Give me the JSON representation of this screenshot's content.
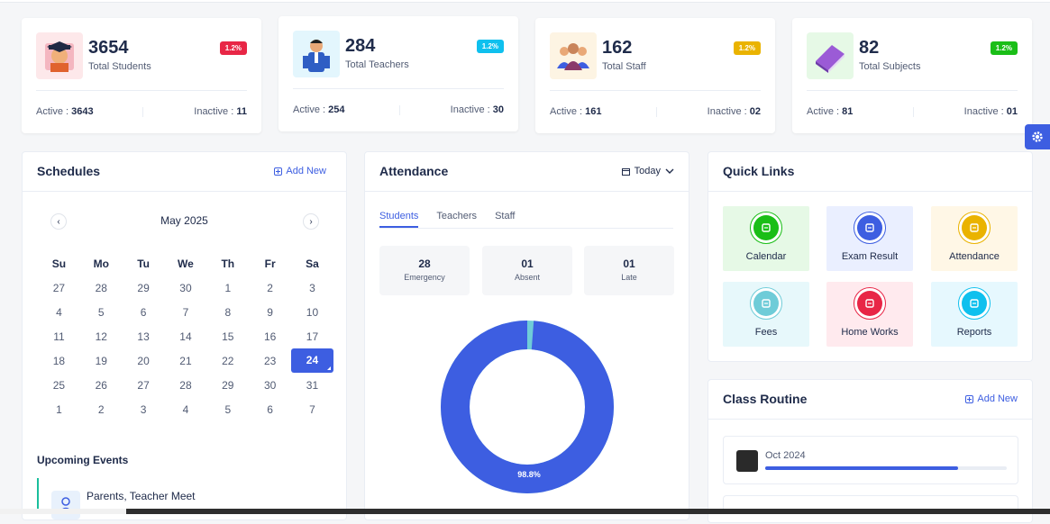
{
  "stats": [
    {
      "value": "3654",
      "label": "Total Students",
      "percent": "1.2%",
      "badge_color": "#e82646",
      "active_label": "Active :",
      "active": "3643",
      "inactive_label": "Inactive :",
      "inactive": "11",
      "icon": "student-graduate-icon"
    },
    {
      "value": "284",
      "label": "Total Teachers",
      "percent": "1.2%",
      "badge_color": "#0fc0ee",
      "active_label": "Active :",
      "active": "254",
      "inactive_label": "Inactive :",
      "inactive": "30",
      "icon": "teacher-icon"
    },
    {
      "value": "162",
      "label": "Total Staff",
      "percent": "1.2%",
      "badge_color": "#eab300",
      "active_label": "Active :",
      "active": "161",
      "inactive_label": "Inactive :",
      "inactive": "02",
      "icon": "staff-group-icon"
    },
    {
      "value": "82",
      "label": "Total Subjects",
      "percent": "1.2%",
      "badge_color": "#1abe17",
      "active_label": "Active :",
      "active": "81",
      "inactive_label": "Inactive :",
      "inactive": "01",
      "icon": "book-icon"
    }
  ],
  "schedules": {
    "title": "Schedules",
    "add_new": "Add New",
    "month": "May 2025",
    "weekdays": [
      "Su",
      "Mo",
      "Tu",
      "We",
      "Th",
      "Fr",
      "Sa"
    ],
    "weeks": [
      [
        "27",
        "28",
        "29",
        "30",
        "1",
        "2",
        "3"
      ],
      [
        "4",
        "5",
        "6",
        "7",
        "8",
        "9",
        "10"
      ],
      [
        "11",
        "12",
        "13",
        "14",
        "15",
        "16",
        "17"
      ],
      [
        "18",
        "19",
        "20",
        "21",
        "22",
        "23",
        "24"
      ],
      [
        "25",
        "26",
        "27",
        "28",
        "29",
        "30",
        "31"
      ],
      [
        "1",
        "2",
        "3",
        "4",
        "5",
        "6",
        "7"
      ]
    ],
    "selected_day": "24",
    "upcoming_title": "Upcoming Events",
    "event_name": "Parents, Teacher Meet"
  },
  "attendance": {
    "title": "Attendance",
    "filter": "Today",
    "tabs": [
      "Students",
      "Teachers",
      "Staff"
    ],
    "active_tab": "Students",
    "boxes": [
      {
        "value": "28",
        "label": "Emergency"
      },
      {
        "value": "01",
        "label": "Absent"
      },
      {
        "value": "01",
        "label": "Late"
      }
    ],
    "donut_label": "98.8%",
    "donut_fraction": 0.988,
    "donut_colors": {
      "main": "#3d5ee1",
      "rest": "#6fccd8"
    }
  },
  "quick_links": {
    "title": "Quick Links",
    "items": [
      {
        "label": "Calendar",
        "bg": "#e6f9e6",
        "color": "#1abe17",
        "icon": "calendar-icon"
      },
      {
        "label": "Exam Result",
        "bg": "#eaefff",
        "color": "#3d5ee1",
        "icon": "exam-result-icon"
      },
      {
        "label": "Attendance",
        "bg": "#fff7e6",
        "color": "#eab300",
        "icon": "attendance-icon"
      },
      {
        "label": "Fees",
        "bg": "#e7f8fb",
        "color": "#6fccd8",
        "icon": "fees-icon"
      },
      {
        "label": "Home Works",
        "bg": "#ffeaee",
        "color": "#e82646",
        "icon": "homework-icon"
      },
      {
        "label": "Reports",
        "bg": "#e6f8fe",
        "color": "#0fc0ee",
        "icon": "reports-icon"
      }
    ]
  },
  "class_routine": {
    "title": "Class Routine",
    "add_new": "Add New",
    "entry_date": "Oct 2024",
    "progress": 0.8
  }
}
